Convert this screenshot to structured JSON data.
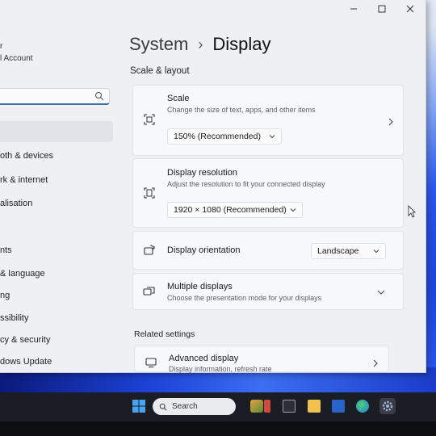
{
  "window": {
    "minimize": "—",
    "maximize": "▢",
    "close": "✕"
  },
  "sidebar": {
    "user_name": "r",
    "user_account": "l Account",
    "search_placeholder": "",
    "items": [
      {
        "label": "oth & devices"
      },
      {
        "label": "rk & internet"
      },
      {
        "label": "alisation"
      },
      {
        "label": "nts"
      },
      {
        "label": "& language"
      },
      {
        "label": "ng"
      },
      {
        "label": "ssibility"
      },
      {
        "label": "cy & security"
      },
      {
        "label": "dows Update"
      }
    ]
  },
  "breadcrumb": {
    "parent": "System",
    "separator": "›",
    "current": "Display"
  },
  "sections": {
    "scale_layout": "Scale & layout",
    "related": "Related settings"
  },
  "scale": {
    "title": "Scale",
    "subtitle": "Change the size of text, apps, and other items",
    "value": "150% (Recommended)"
  },
  "resolution": {
    "title": "Display resolution",
    "subtitle": "Adjust the resolution to fit your connected display",
    "value": "1920 × 1080 (Recommended)"
  },
  "orientation": {
    "title": "Display orientation",
    "value": "Landscape"
  },
  "multiple": {
    "title": "Multiple displays",
    "subtitle": "Choose the presentation mode for your displays"
  },
  "advanced": {
    "title": "Advanced display",
    "subtitle": "Display information, refresh rate"
  },
  "taskbar": {
    "search_label": "Search"
  },
  "colors": {
    "accent": "#3a6ea5",
    "window_bg": "#eef0f4",
    "taskbar_bg": "#1b1d24"
  }
}
